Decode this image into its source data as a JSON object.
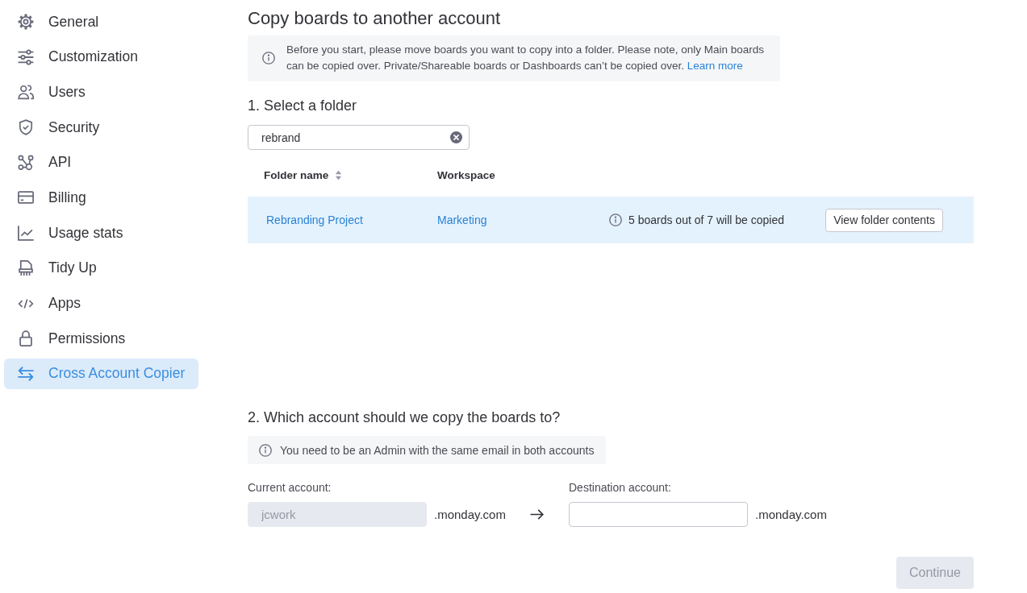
{
  "sidebar": {
    "items": [
      {
        "label": "General",
        "selected": false
      },
      {
        "label": "Customization",
        "selected": false
      },
      {
        "label": "Users",
        "selected": false
      },
      {
        "label": "Security",
        "selected": false
      },
      {
        "label": "API",
        "selected": false
      },
      {
        "label": "Billing",
        "selected": false
      },
      {
        "label": "Usage stats",
        "selected": false
      },
      {
        "label": "Tidy Up",
        "selected": false
      },
      {
        "label": "Apps",
        "selected": false
      },
      {
        "label": "Permissions",
        "selected": false
      },
      {
        "label": "Cross Account Copier",
        "selected": true
      }
    ]
  },
  "page_title": "Copy boards to another account",
  "notice": {
    "text": "Before you start, please move boards you want to copy into a folder. Please note, only Main boards can be copied over. Private/Shareable boards or Dashboards can’t be copied over.",
    "link": "Learn more"
  },
  "folder_step": {
    "heading": "1. Select a folder",
    "search": {
      "value": "rebrand"
    },
    "table": {
      "columns": [
        {
          "label": "Folder name",
          "sortable": true
        },
        {
          "label": "Workspace",
          "sortable": false
        }
      ],
      "rows": [
        {
          "folder_name": "Rebranding Project",
          "workspace": "Marketing",
          "copy_status": "5 boards out of 7 will be copied",
          "action": "View folder contents",
          "selected": true
        }
      ]
    }
  },
  "account_step": {
    "heading": "2. Which account should we copy the boards to?",
    "notice": "You need to be an Admin with the same email in both accounts",
    "current_account": {
      "label": "Current account:",
      "value": "jcwork",
      "disabled": true,
      "suffix": ".monday.com"
    },
    "destination_account": {
      "label": "Destination account:",
      "suffix": ".monday.com"
    }
  },
  "continue_button": {
    "label": "Continue",
    "disabled": true
  }
}
